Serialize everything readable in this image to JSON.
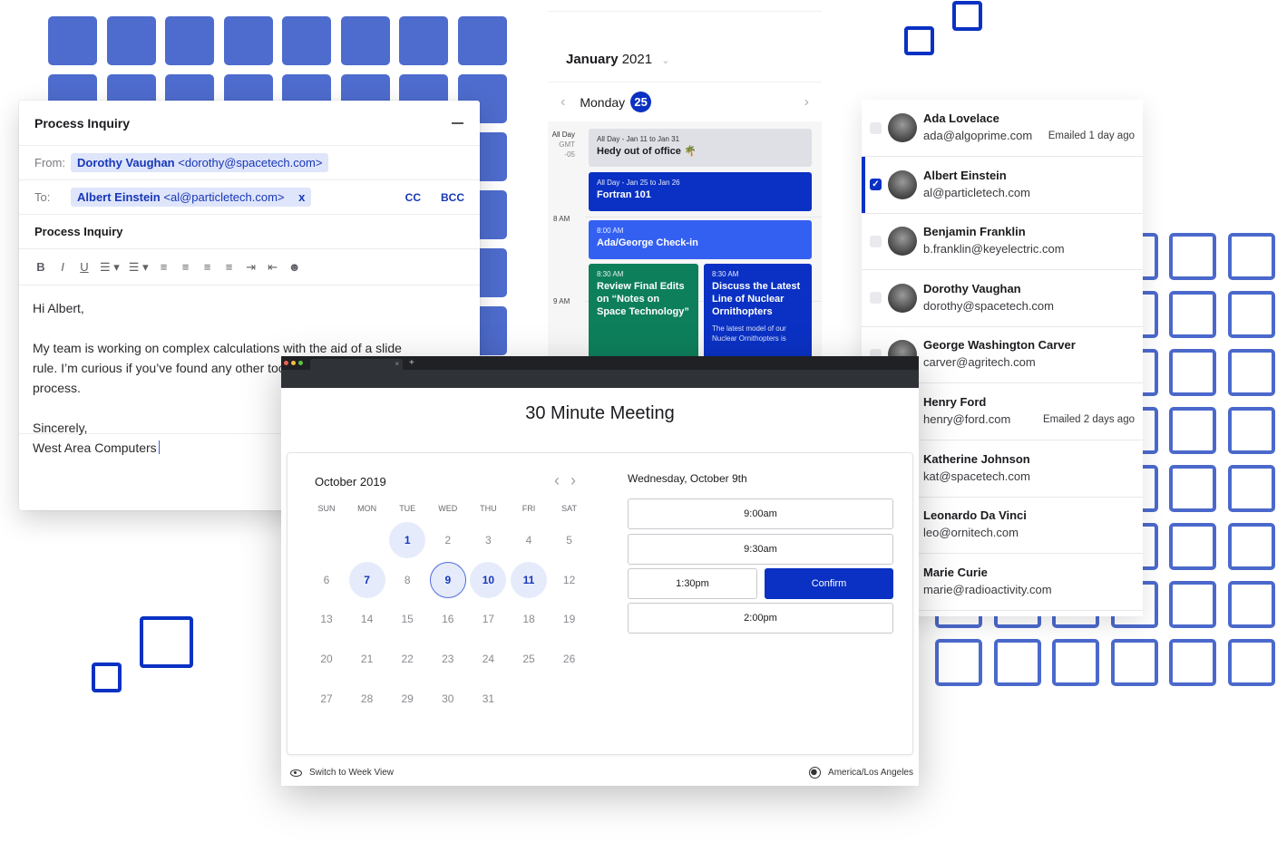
{
  "email": {
    "title": "Process Inquiry",
    "from_label": "From:",
    "from_name": "Dorothy Vaughan",
    "from_email": "<dorothy@spacetech.com>",
    "to_label": "To:",
    "to_name": "Albert Einstein",
    "to_email": "<al@particletech.com>",
    "to_remove": "x",
    "cc_label": "CC",
    "bcc_label": "BCC",
    "subject": "Process Inquiry",
    "toolbar": [
      "B",
      "I",
      "U",
      "☰ ▾",
      "☰ ▾",
      "≡",
      "≡",
      "≡",
      "≡",
      "⇥",
      "⇤",
      "☻"
    ],
    "body": {
      "greeting": "Hi Albert,",
      "paragraph": "My team is working on complex calculations with the aid of a slide rule. I’m curious if you’ve found any other tools to help with this process.",
      "closing": "Sincerely,",
      "signature": "West Area Computers"
    }
  },
  "day_calendar": {
    "month": "January",
    "year": "2021",
    "weekday": "Monday",
    "day_number": "25",
    "allday_label": "All Day",
    "tz_label": "GMT",
    "tz_offset": "-05",
    "hours": [
      "8 AM",
      "9 AM"
    ],
    "events": [
      {
        "time": "All Day - Jan 11 to Jan 31",
        "name": "Hedy out of office 🌴",
        "color": "#dfe0e6"
      },
      {
        "time": "All Day - Jan 25 to Jan 26",
        "name": "Fortran 101",
        "color": "#0a31c3"
      },
      {
        "time": "8:00 AM",
        "name": "Ada/George Check-in",
        "color": "#3460f1"
      },
      {
        "time": "8:30 AM",
        "name": "Review Final Edits on “Notes on Space Technology”",
        "color": "#0e7f5b"
      },
      {
        "time": "8:30 AM",
        "name": "Discuss the Latest Line of Nuclear Ornithopters",
        "desc": "The latest model of our Nuclear Ornithopters is",
        "color": "#0a31c3"
      }
    ]
  },
  "contacts": [
    {
      "name": "Ada Lovelace",
      "email": "ada@algoprime.com",
      "status": "Emailed 1 day ago",
      "checked": false
    },
    {
      "name": "Albert Einstein",
      "email": "al@particletech.com",
      "status": "",
      "checked": true
    },
    {
      "name": "Benjamin Franklin",
      "email": "b.franklin@keyelectric.com",
      "status": "",
      "checked": false
    },
    {
      "name": "Dorothy Vaughan",
      "email": "dorothy@spacetech.com",
      "status": "",
      "checked": false
    },
    {
      "name": "George Washington Carver",
      "email": "carver@agritech.com",
      "status": "",
      "checked": false
    },
    {
      "name": "Henry Ford",
      "email": "henry@ford.com",
      "status": "Emailed 2 days ago",
      "checked": false
    },
    {
      "name": "Katherine Johnson",
      "email": "kat@spacetech.com",
      "status": "",
      "checked": false
    },
    {
      "name": "Leonardo Da Vinci",
      "email": "leo@ornitech.com",
      "status": "",
      "checked": false
    },
    {
      "name": "Marie Curie",
      "email": "marie@radioactivity.com",
      "status": "",
      "checked": false
    }
  ],
  "scheduler": {
    "tab_close": "×",
    "new_tab": "+",
    "title": "30 Minute Meeting",
    "month_label": "October 2019",
    "prev": "‹",
    "next": "›",
    "weekdays": [
      "SUN",
      "MON",
      "TUE",
      "WED",
      "THU",
      "FRI",
      "SAT"
    ],
    "first_weekday_index": 2,
    "days_in_month": 31,
    "available_days": [
      1,
      7,
      10,
      11
    ],
    "selected_day": 9,
    "selected_date_label": "Wednesday, October 9th",
    "slots": [
      "9:00am",
      "9:30am",
      "1:30pm",
      "2:00pm"
    ],
    "selected_slot": "1:30pm",
    "confirm_label": "Confirm",
    "switch_view_label": "Switch to Week View",
    "timezone": "America/Los Angeles"
  },
  "colors": {
    "brand": "#0a31c3",
    "deco_fill": "#4e6ccd",
    "chip_bg": "#dfe5fa",
    "green_event": "#0e7f5b"
  }
}
